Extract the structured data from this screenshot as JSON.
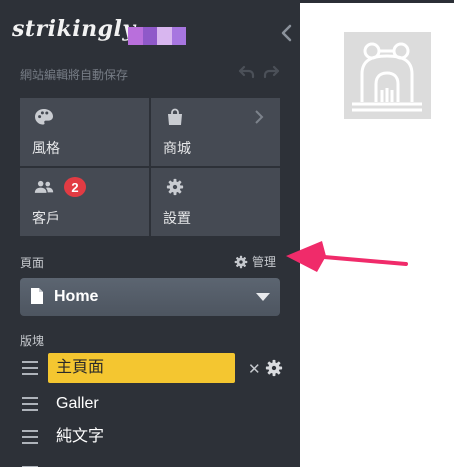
{
  "app": {
    "logo_text": "strikingly"
  },
  "header": {
    "autosave_text": "網站編輯將自動保存"
  },
  "tiles": [
    {
      "label": "風格",
      "icon": "palette-icon"
    },
    {
      "label": "商城",
      "icon": "shopping-bag-icon"
    },
    {
      "label": "客戶",
      "icon": "users-icon",
      "badge": "2"
    },
    {
      "label": "設置",
      "icon": "settings-gear-icon"
    }
  ],
  "pages": {
    "label": "頁面",
    "manage_label": "管理",
    "selected": "Home"
  },
  "sections": {
    "label": "版塊",
    "items": [
      {
        "label": "主頁面"
      },
      {
        "label": "Galler"
      },
      {
        "label": "純文字"
      }
    ]
  },
  "colors": {
    "sidebar_bg": "#2d3138",
    "tile_bg": "#454a53",
    "active_section": "#f4c630",
    "badge": "#e23b43",
    "annotation_arrow": "#f02b6a"
  }
}
